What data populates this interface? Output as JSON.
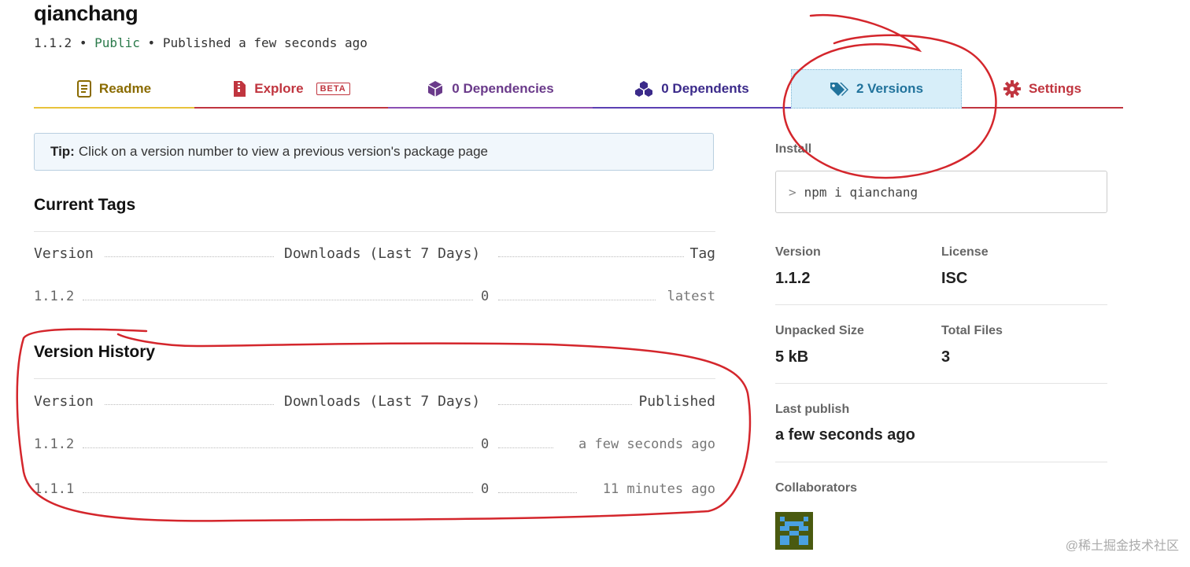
{
  "package": {
    "name": "qianchang",
    "version": "1.1.2",
    "visibility": "Public",
    "published": "Published a few seconds ago",
    "separator": "•"
  },
  "tabs": [
    {
      "label": "Readme",
      "icon": "readme-icon",
      "color": "#8a6b00"
    },
    {
      "label": "Explore",
      "icon": "zip-file-icon",
      "color": "#c0353f",
      "badge": "BETA"
    },
    {
      "label": "0 Dependencies",
      "icon": "box-icon",
      "color": "#6a3a8a"
    },
    {
      "label": "0 Dependents",
      "icon": "cubes-icon",
      "color": "#3b2a8a"
    },
    {
      "label": "2 Versions",
      "icon": "tags-icon",
      "color": "#21739c",
      "active": true
    },
    {
      "label": "Settings",
      "icon": "gear-icon",
      "color": "#c0353f"
    }
  ],
  "tip": {
    "bold": "Tip:",
    "text": "Click on a version number to view a previous version's package page"
  },
  "current_tags": {
    "title": "Current Tags",
    "headers": [
      "Version",
      "Downloads (Last 7 Days)",
      "Tag"
    ],
    "rows": [
      {
        "version": "1.1.2",
        "downloads": "0",
        "tag": "latest"
      }
    ]
  },
  "version_history": {
    "title": "Version History",
    "headers": [
      "Version",
      "Downloads (Last 7 Days)",
      "Published"
    ],
    "rows": [
      {
        "version": "1.1.2",
        "downloads": "0",
        "published": "a few seconds ago"
      },
      {
        "version": "1.1.1",
        "downloads": "0",
        "published": "11 minutes ago"
      }
    ]
  },
  "sidebar": {
    "install_label": "Install",
    "install_prompt": ">",
    "install_command": "npm i qianchang",
    "version_label": "Version",
    "version_value": "1.1.2",
    "license_label": "License",
    "license_value": "ISC",
    "unpacked_label": "Unpacked Size",
    "unpacked_value": "5 kB",
    "files_label": "Total Files",
    "files_value": "3",
    "last_publish_label": "Last publish",
    "last_publish_value": "a few seconds ago",
    "collaborators_label": "Collaborators"
  },
  "watermark": "@稀土掘金技术社区",
  "colors": {
    "annotation": "#d4262c",
    "active_tab_bg": "#d7eef9",
    "visibility": "#2b7a4b"
  }
}
